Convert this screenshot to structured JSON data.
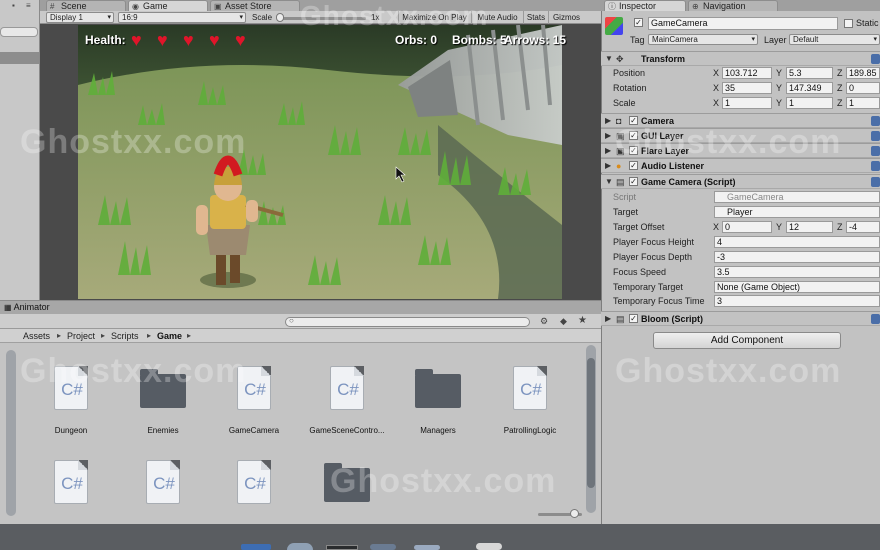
{
  "tabs": {
    "scene": "Scene",
    "game": "Game",
    "asset_store": "Asset Store",
    "inspector": "Inspector",
    "navigation": "Navigation",
    "animator": "Animator"
  },
  "game_toolbar": {
    "display": "Display 1",
    "aspect": "16:9",
    "scale_label": "Scale",
    "scale_value": "1x",
    "maximize": "Maximize On Play",
    "mute": "Mute Audio",
    "stats": "Stats",
    "gizmos": "Gizmos"
  },
  "hud": {
    "health_label": "Health:",
    "hearts": 5,
    "orbs": "Orbs: 0",
    "bombs": "Bombs: 5",
    "arrows": "Arrows: 15"
  },
  "watermark": "Ghostxx.com",
  "inspector": {
    "object_name": "GameCamera",
    "static_label": "Static",
    "tag_label": "Tag",
    "tag_value": "MainCamera",
    "layer_label": "Layer",
    "layer_value": "Default",
    "transform": {
      "title": "Transform",
      "position_label": "Position",
      "rotation_label": "Rotation",
      "scale_label": "Scale",
      "position": {
        "x": "103.712",
        "y": "5.3",
        "z": "189.85"
      },
      "rotation": {
        "x": "35",
        "y": "147.349",
        "z": "0"
      },
      "scale": {
        "x": "1",
        "y": "1",
        "z": "1"
      }
    },
    "components": {
      "camera": "Camera",
      "gui_layer": "GUI Layer",
      "flare_layer": "Flare Layer",
      "audio_listener": "Audio Listener",
      "game_camera_script": "Game Camera (Script)",
      "bloom_script": "Bloom (Script)"
    },
    "script_fields": {
      "script_label": "Script",
      "script_value": "GameCamera",
      "target_label": "Target",
      "target_value": "Player",
      "target_offset_label": "Target Offset",
      "target_offset": {
        "x": "0",
        "y": "12",
        "z": "-4"
      },
      "focus_height_label": "Player Focus Height",
      "focus_height": "4",
      "focus_depth_label": "Player Focus Depth",
      "focus_depth": "-3",
      "focus_speed_label": "Focus Speed",
      "focus_speed": "3.5",
      "temp_target_label": "Temporary Target",
      "temp_target": "None (Game Object)",
      "temp_focus_time_label": "Temporary Focus Time",
      "temp_focus_time": "3"
    },
    "add_component": "Add Component",
    "axis": {
      "x": "X",
      "y": "Y",
      "z": "Z"
    }
  },
  "project": {
    "breadcrumb": [
      "Assets",
      "Project",
      "Scripts",
      "Game"
    ],
    "assets": [
      {
        "name": "Dungeon",
        "type": "script"
      },
      {
        "name": "Enemies",
        "type": "folder"
      },
      {
        "name": "GameCamera",
        "type": "script"
      },
      {
        "name": "GameSceneContro...",
        "type": "script"
      },
      {
        "name": "Managers",
        "type": "folder"
      },
      {
        "name": "PatrollingLogic",
        "type": "script"
      },
      {
        "name": "",
        "type": "script"
      },
      {
        "name": "",
        "type": "script"
      },
      {
        "name": "",
        "type": "script"
      },
      {
        "name": "",
        "type": "folder"
      }
    ]
  },
  "colors": {
    "heart": "#e0152a",
    "panel": "#c2c2c2",
    "help_icon": "#4a6ea8"
  }
}
